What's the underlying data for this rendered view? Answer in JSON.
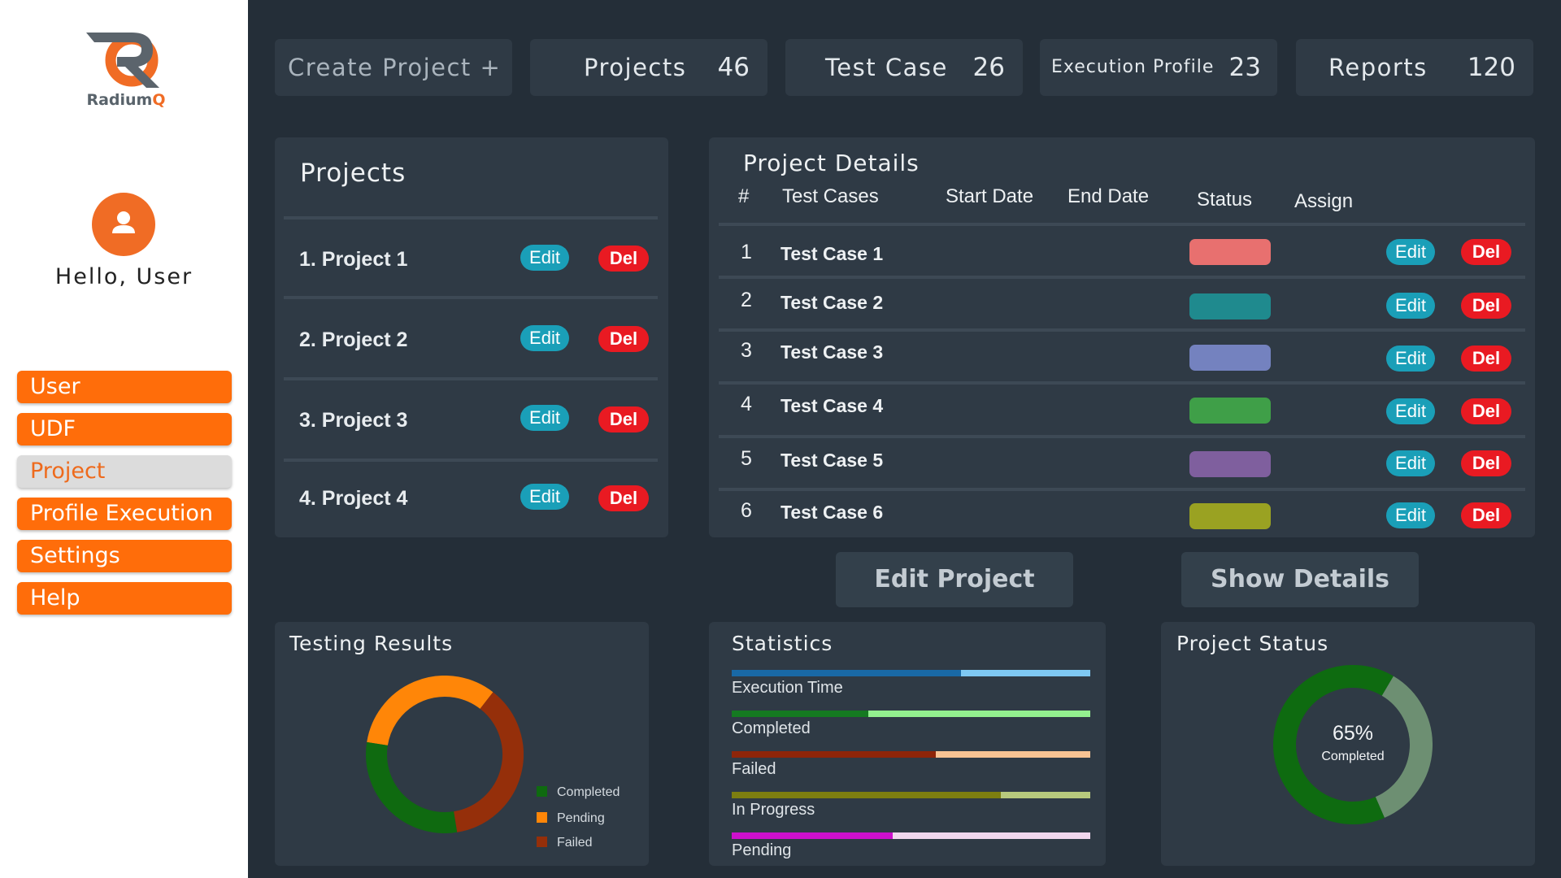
{
  "sidebar": {
    "logo": {
      "brand": "Radium",
      "brand_accent": "Q"
    },
    "greeting": "Hello, User",
    "nav": [
      {
        "label": "User",
        "active": false
      },
      {
        "label": "UDF",
        "active": false
      },
      {
        "label": "Project",
        "active": true
      },
      {
        "label": "Profile Execution",
        "active": false
      },
      {
        "label": "Settings",
        "active": false
      },
      {
        "label": "Help",
        "active": false
      }
    ]
  },
  "top_stats": [
    {
      "label": "Create Project  +",
      "value": ""
    },
    {
      "label": "Projects",
      "value": "46"
    },
    {
      "label": "Test Case",
      "value": "26"
    },
    {
      "label": "Execution Profile",
      "value": "23"
    },
    {
      "label": "Reports",
      "value": "120"
    }
  ],
  "projects_panel": {
    "title": "Projects",
    "items": [
      {
        "name": "1. Project 1",
        "edit": "Edit",
        "del": "Del"
      },
      {
        "name": "2. Project 2",
        "edit": "Edit",
        "del": "Del"
      },
      {
        "name": "3. Project 3",
        "edit": "Edit",
        "del": "Del"
      },
      {
        "name": "4. Project 4",
        "edit": "Edit",
        "del": "Del"
      }
    ]
  },
  "details_panel": {
    "title": "Project Details",
    "headers": [
      "#",
      "Test Cases",
      "Start Date",
      "End Date",
      "Status",
      "Assign"
    ],
    "rows": [
      {
        "num": "1",
        "name": "Test Case 1",
        "status_color": "#e8706f",
        "edit": "Edit",
        "del": "Del"
      },
      {
        "num": "2",
        "name": "Test Case 2",
        "status_color": "#1f8a8e",
        "edit": "Edit",
        "del": "Del"
      },
      {
        "num": "3",
        "name": "Test Case 3",
        "status_color": "#7482bf",
        "edit": "Edit",
        "del": "Del"
      },
      {
        "num": "4",
        "name": "Test Case 4",
        "status_color": "#3f9f48",
        "edit": "Edit",
        "del": "Del"
      },
      {
        "num": "5",
        "name": "Test Case 5",
        "status_color": "#7f5f9e",
        "edit": "Edit",
        "del": "Del"
      },
      {
        "num": "6",
        "name": "Test Case 6",
        "status_color": "#9aa222",
        "edit": "Edit",
        "del": "Del"
      }
    ]
  },
  "actions": {
    "edit_project": "Edit Project",
    "show_details": "Show Details"
  },
  "testing_results": {
    "title": "Testing Results",
    "legend": [
      {
        "label": "Completed",
        "color": "#0f6a10"
      },
      {
        "label": "Pending",
        "color": "#ff8608"
      },
      {
        "label": "Failed",
        "color": "#952f0a"
      }
    ]
  },
  "statistics": {
    "title": "Statistics",
    "bars": [
      {
        "label": "Execution Time",
        "fraction": 0.64,
        "fill": "#1969a6",
        "track": "#7ec8f2"
      },
      {
        "label": "Completed",
        "fraction": 0.38,
        "fill": "#157a21",
        "track": "#93f08f"
      },
      {
        "label": "Failed",
        "fraction": 0.57,
        "fill": "#8e2509",
        "track": "#f8c393"
      },
      {
        "label": "In Progress",
        "fraction": 0.75,
        "fill": "#7d7e10",
        "track": "#b7c97d"
      },
      {
        "label": "Pending",
        "fraction": 0.45,
        "fill": "#cc10cc",
        "track": "#f1d7ee"
      }
    ]
  },
  "project_status": {
    "title": "Project Status",
    "percent": "65%",
    "caption": "Completed",
    "fraction": 0.65
  },
  "chart_data": [
    {
      "type": "pie",
      "title": "Testing Results",
      "categories": [
        "Completed",
        "Pending",
        "Failed"
      ],
      "values": [
        30,
        33,
        37
      ],
      "colors": [
        "#0f6a10",
        "#ff8608",
        "#952f0a"
      ],
      "legend": "bottom-right"
    },
    {
      "type": "bar",
      "title": "Statistics",
      "categories": [
        "Execution Time",
        "Completed",
        "Failed",
        "In Progress",
        "Pending"
      ],
      "values": [
        0.64,
        0.38,
        0.57,
        0.75,
        0.45
      ]
    },
    {
      "type": "pie",
      "title": "Project Status",
      "categories": [
        "Completed",
        "Remaining"
      ],
      "values": [
        65,
        35
      ],
      "colors": [
        "#0e6b10",
        "#6d8f72"
      ]
    }
  ]
}
